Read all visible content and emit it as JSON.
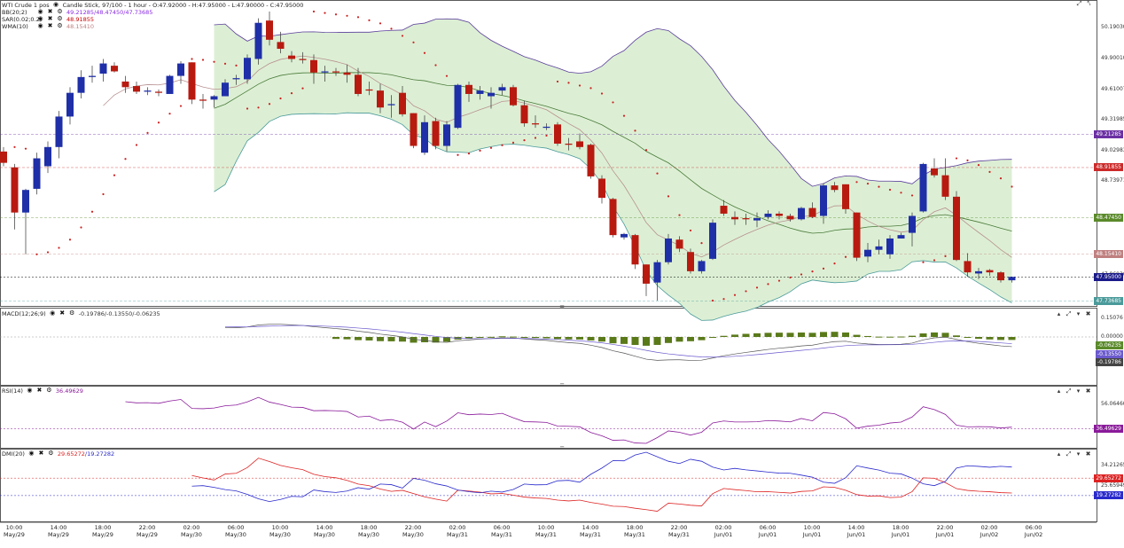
{
  "main": {
    "title": "WTI Crude 1 pos",
    "chart_type": "Candle Stick, 97/100 - 1 hour - O:47.92000 - H:47.95000 - L:47.90000 - C:47.95000",
    "indicators": [
      {
        "name": "BB(20;2)",
        "values": "49.21285/48.47450/47.73685",
        "color": "#8a2be2"
      },
      {
        "name": "SAR(0.02;0.2)",
        "values": "48.91855",
        "color": "#cc0000"
      },
      {
        "name": "WMA(10)",
        "values": "48.15410",
        "color": "#c08080"
      }
    ],
    "price_labels": [
      "50.19030",
      "49.90010",
      "49.61007",
      "49.31985",
      "49.02983",
      "48.73971",
      "47.86936"
    ],
    "tags": [
      {
        "text": "49.21285",
        "color": "#6b2fa3",
        "value": 49.21285
      },
      {
        "text": "48.91855",
        "color": "#cc2a2a",
        "value": 48.91855
      },
      {
        "text": "48.47450",
        "color": "#5a8a2a",
        "value": 48.4745
      },
      {
        "text": "48.15410",
        "color": "#c08080",
        "value": 48.1541
      },
      {
        "text": "47.95000",
        "color": "#1a1a8a",
        "value": 47.95
      },
      {
        "text": "47.73685",
        "color": "#4a9a9a",
        "value": 47.73685
      }
    ]
  },
  "macd": {
    "label": "MACD(12;26;9)",
    "values": "-0.19786/-0.13550/-0.06235",
    "price_labels": [
      "0.15076",
      "0.00000"
    ],
    "tags": [
      {
        "text": "-0.06235",
        "color": "#5a8a2a"
      },
      {
        "text": "-0.13550",
        "color": "#6a5acd"
      },
      {
        "text": "-0.19786",
        "color": "#444444"
      }
    ]
  },
  "rsi": {
    "label": "RSI(14)",
    "values": "36.49629",
    "price_labels": [
      "56.06460"
    ],
    "tags": [
      {
        "text": "36.49629",
        "color": "#8a1a9a"
      }
    ]
  },
  "dmi": {
    "label": "DMI(20)",
    "values_plus": "29.65272",
    "values_minus": "/19.27282",
    "price_labels": [
      "34.21265",
      "25.65949"
    ],
    "tags": [
      {
        "text": "29.65272",
        "color": "#dd2222"
      },
      {
        "text": "19.27282",
        "color": "#2a2acc"
      }
    ]
  },
  "x_axis": [
    {
      "time": "10:00",
      "date": "May/29"
    },
    {
      "time": "14:00",
      "date": "May/29"
    },
    {
      "time": "18:00",
      "date": "May/29"
    },
    {
      "time": "22:00",
      "date": "May/29"
    },
    {
      "time": "02:00",
      "date": "May/30"
    },
    {
      "time": "06:00",
      "date": "May/30"
    },
    {
      "time": "10:00",
      "date": "May/30"
    },
    {
      "time": "14:00",
      "date": "May/30"
    },
    {
      "time": "18:00",
      "date": "May/30"
    },
    {
      "time": "22:00",
      "date": "May/30"
    },
    {
      "time": "02:00",
      "date": "May/31"
    },
    {
      "time": "06:00",
      "date": "May/31"
    },
    {
      "time": "10:00",
      "date": "May/31"
    },
    {
      "time": "14:00",
      "date": "May/31"
    },
    {
      "time": "18:00",
      "date": "May/31"
    },
    {
      "time": "22:00",
      "date": "May/31"
    },
    {
      "time": "02:00",
      "date": "Jun/01"
    },
    {
      "time": "06:00",
      "date": "Jun/01"
    },
    {
      "time": "10:00",
      "date": "Jun/01"
    },
    {
      "time": "14:00",
      "date": "Jun/01"
    },
    {
      "time": "18:00",
      "date": "Jun/01"
    },
    {
      "time": "22:00",
      "date": "Jun/01"
    },
    {
      "time": "02:00",
      "date": "Jun/02"
    },
    {
      "time": "06:00",
      "date": "Jun/02"
    }
  ],
  "icons": {
    "eye": "eye-icon",
    "close": "close-icon",
    "gear": "gear-icon",
    "expand": "expand-icon",
    "collapse": "collapse-icon",
    "up": "arrow-up-icon",
    "down": "arrow-down-icon"
  },
  "chart_data": {
    "type": "candlestick",
    "title": "WTI Crude 1 pos",
    "ylim": [
      47.74,
      50.3
    ],
    "candles": [
      [
        49.06,
        49.1,
        48.93,
        48.96
      ],
      [
        48.92,
        48.95,
        48.37,
        48.52
      ],
      [
        48.52,
        48.73,
        48.15,
        48.72
      ],
      [
        48.73,
        49.05,
        48.68,
        49.0
      ],
      [
        48.93,
        49.15,
        48.87,
        49.1
      ],
      [
        49.1,
        49.42,
        49.0,
        49.37
      ],
      [
        49.37,
        49.63,
        49.3,
        49.58
      ],
      [
        49.58,
        49.78,
        49.53,
        49.72
      ],
      [
        49.72,
        49.82,
        49.67,
        49.73
      ],
      [
        49.75,
        49.88,
        49.68,
        49.84
      ],
      [
        49.82,
        49.85,
        49.76,
        49.77
      ],
      [
        49.68,
        49.73,
        49.58,
        49.63
      ],
      [
        49.64,
        49.68,
        49.57,
        49.59
      ],
      [
        49.59,
        49.63,
        49.56,
        49.6
      ],
      [
        49.59,
        49.61,
        49.55,
        49.58
      ],
      [
        49.57,
        49.74,
        49.57,
        49.73
      ],
      [
        49.73,
        49.86,
        49.66,
        49.84
      ],
      [
        49.85,
        49.85,
        49.48,
        49.52
      ],
      [
        49.52,
        49.57,
        49.44,
        49.51
      ],
      [
        49.52,
        49.56,
        49.45,
        49.55
      ],
      [
        49.55,
        49.7,
        49.55,
        49.67
      ],
      [
        49.7,
        49.74,
        49.65,
        49.71
      ],
      [
        49.7,
        49.92,
        49.66,
        49.89
      ],
      [
        49.88,
        50.24,
        49.83,
        50.2
      ],
      [
        50.22,
        50.3,
        50.0,
        50.05
      ],
      [
        50.03,
        50.12,
        49.93,
        49.97
      ],
      [
        49.91,
        49.95,
        49.85,
        49.88
      ],
      [
        49.88,
        49.94,
        49.84,
        49.87
      ],
      [
        49.87,
        49.92,
        49.66,
        49.76
      ],
      [
        49.76,
        49.82,
        49.68,
        49.77
      ],
      [
        49.77,
        49.8,
        49.73,
        49.76
      ],
      [
        49.76,
        49.83,
        49.67,
        49.74
      ],
      [
        49.74,
        49.8,
        49.55,
        49.57
      ],
      [
        49.61,
        49.68,
        49.56,
        49.6
      ],
      [
        49.6,
        49.66,
        49.4,
        49.45
      ],
      [
        49.47,
        49.56,
        49.36,
        49.48
      ],
      [
        49.58,
        49.64,
        49.37,
        49.39
      ],
      [
        49.4,
        49.4,
        49.09,
        49.11
      ],
      [
        49.05,
        49.38,
        49.03,
        49.32
      ],
      [
        49.33,
        49.36,
        49.08,
        49.11
      ],
      [
        49.11,
        49.33,
        49.06,
        49.3
      ],
      [
        49.27,
        49.66,
        49.26,
        49.65
      ],
      [
        49.65,
        49.68,
        49.5,
        49.57
      ],
      [
        49.57,
        49.64,
        49.52,
        49.6
      ],
      [
        49.55,
        49.63,
        49.44,
        49.58
      ],
      [
        49.6,
        49.66,
        49.56,
        49.63
      ],
      [
        49.63,
        49.65,
        49.46,
        49.47
      ],
      [
        49.47,
        49.51,
        49.28,
        49.31
      ],
      [
        49.31,
        49.38,
        49.27,
        49.3
      ],
      [
        49.27,
        49.31,
        49.25,
        49.28
      ],
      [
        49.3,
        49.32,
        49.11,
        49.13
      ],
      [
        49.13,
        49.18,
        49.07,
        49.12
      ],
      [
        49.15,
        49.22,
        49.08,
        49.1
      ],
      [
        49.12,
        49.13,
        48.82,
        48.84
      ],
      [
        48.82,
        48.85,
        48.6,
        48.65
      ],
      [
        48.64,
        48.65,
        48.3,
        48.32
      ],
      [
        48.3,
        48.34,
        48.28,
        48.33
      ],
      [
        48.32,
        48.33,
        48.02,
        48.06
      ],
      [
        48.06,
        48.06,
        47.78,
        47.89
      ],
      [
        47.9,
        48.1,
        47.74,
        48.08
      ],
      [
        48.08,
        48.33,
        48.06,
        48.29
      ],
      [
        48.28,
        48.31,
        48.17,
        48.2
      ],
      [
        48.17,
        48.2,
        47.98,
        48.0
      ],
      [
        48.0,
        48.1,
        47.98,
        48.09
      ],
      [
        48.11,
        48.46,
        48.1,
        48.43
      ],
      [
        48.58,
        48.63,
        48.49,
        48.51
      ],
      [
        48.48,
        48.53,
        48.41,
        48.46
      ],
      [
        48.47,
        48.51,
        48.41,
        48.46
      ],
      [
        48.45,
        48.52,
        48.39,
        48.47
      ],
      [
        48.48,
        48.54,
        48.46,
        48.51
      ],
      [
        48.51,
        48.53,
        48.46,
        48.49
      ],
      [
        48.49,
        48.51,
        48.44,
        48.46
      ],
      [
        48.46,
        48.57,
        48.45,
        48.56
      ],
      [
        48.56,
        48.61,
        48.47,
        48.48
      ],
      [
        48.49,
        48.78,
        48.42,
        48.76
      ],
      [
        48.76,
        48.79,
        48.7,
        48.72
      ],
      [
        48.77,
        48.77,
        48.51,
        48.55
      ],
      [
        48.52,
        48.52,
        48.09,
        48.12
      ],
      [
        48.13,
        48.25,
        48.08,
        48.19
      ],
      [
        48.19,
        48.28,
        48.15,
        48.22
      ],
      [
        48.15,
        48.32,
        48.11,
        48.29
      ],
      [
        48.29,
        48.34,
        48.29,
        48.32
      ],
      [
        48.34,
        48.52,
        48.22,
        48.49
      ],
      [
        48.53,
        48.96,
        48.52,
        48.95
      ],
      [
        48.91,
        49.0,
        48.83,
        48.85
      ],
      [
        48.85,
        49.0,
        48.63,
        48.66
      ],
      [
        48.66,
        48.71,
        48.09,
        48.1
      ],
      [
        48.09,
        48.16,
        47.95,
        47.99
      ],
      [
        47.98,
        48.03,
        47.93,
        48.0
      ],
      [
        48.01,
        48.02,
        47.96,
        47.99
      ],
      [
        47.99,
        48.0,
        47.9,
        47.92
      ],
      [
        47.92,
        47.95,
        47.9,
        47.95
      ]
    ]
  }
}
